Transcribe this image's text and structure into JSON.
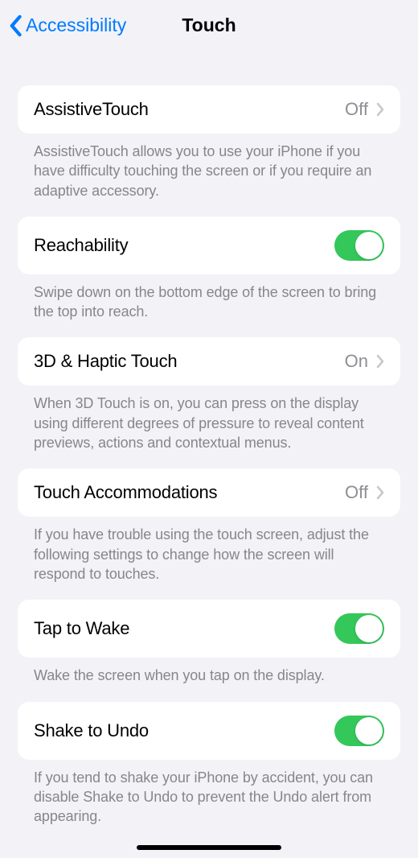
{
  "header": {
    "back_label": "Accessibility",
    "title": "Touch"
  },
  "groups": [
    {
      "label": "AssistiveTouch",
      "value": "Off",
      "footer": "AssistiveTouch allows you to use your iPhone if you have difficulty touching the screen or if you require an adaptive accessory."
    },
    {
      "label": "Reachability",
      "footer": "Swipe down on the bottom edge of the screen to bring the top into reach."
    },
    {
      "label": "3D & Haptic Touch",
      "value": "On",
      "footer": "When 3D Touch is on, you can press on the display using different degrees of pressure to reveal content previews, actions and contextual menus."
    },
    {
      "label": "Touch Accommodations",
      "value": "Off",
      "footer": "If you have trouble using the touch screen, adjust the following settings to change how the screen will respond to touches."
    },
    {
      "label": "Tap to Wake",
      "footer": "Wake the screen when you tap on the display."
    },
    {
      "label": "Shake to Undo",
      "footer": "If you tend to shake your iPhone by accident, you can disable Shake to Undo to prevent the Undo alert from appearing."
    }
  ]
}
